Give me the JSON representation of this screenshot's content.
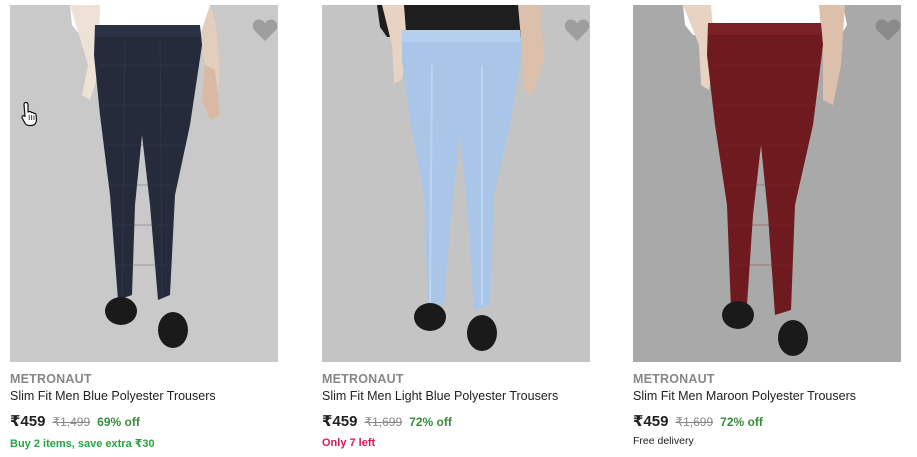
{
  "products": [
    {
      "brand": "METRONAUT",
      "title": "Slim Fit Men Blue Polyester Trousers",
      "price": "₹459",
      "mrp": "₹1,499",
      "discount": "69% off",
      "note": "Buy 2 items, save extra ₹30",
      "note_type": "offer",
      "bg_color": "#c9c9c9",
      "trouser_color": "#262b3c",
      "shirt_color": "#ffffff",
      "icon": "heart-icon"
    },
    {
      "brand": "METRONAUT",
      "title": "Slim Fit Men Light Blue Polyester Trousers",
      "price": "₹459",
      "mrp": "₹1,699",
      "discount": "72% off",
      "note": "Only 7 left",
      "note_type": "stock",
      "bg_color": "#c4c4c4",
      "trouser_color": "#a9c6e8",
      "shirt_color": "#1e1e1e",
      "icon": "heart-icon"
    },
    {
      "brand": "METRONAUT",
      "title": "Slim Fit Men Maroon Polyester Trousers",
      "price": "₹459",
      "mrp": "₹1,699",
      "discount": "72% off",
      "note": "Free delivery",
      "note_type": "delivery",
      "bg_color": "#a9a9a9",
      "trouser_color": "#6e1a1f",
      "shirt_color": "#ffffff",
      "icon": "heart-icon"
    }
  ],
  "colors": {
    "brand_text": "#878787",
    "title_text": "#212121",
    "discount_green": "#388e3c",
    "offer_green": "#26a541",
    "stock_pink": "#d1185a",
    "wishlist_grey": "#9e9e9e"
  },
  "cursor_icon": "hand-pointer-icon"
}
